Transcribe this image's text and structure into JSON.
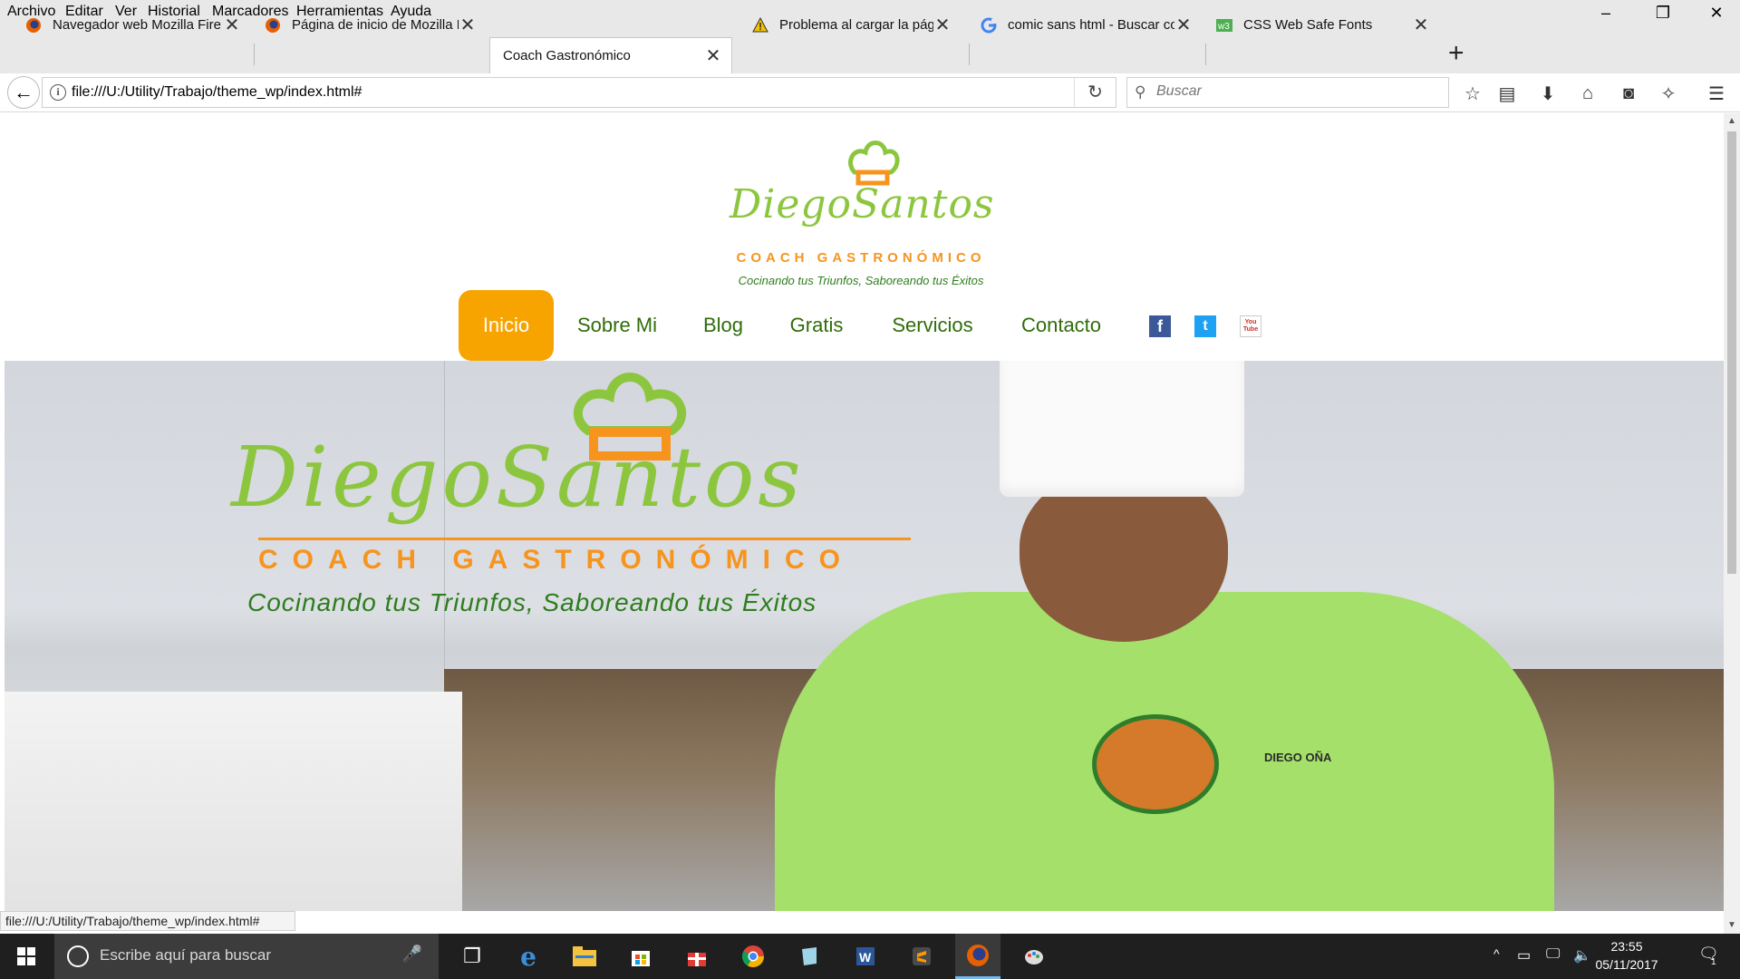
{
  "menu": [
    "Archivo",
    "Editar",
    "Ver",
    "Historial",
    "Marcadores",
    "Herramientas",
    "Ayuda"
  ],
  "window_controls": {
    "minimize": "–",
    "restore": "❐",
    "close": "✕"
  },
  "tabs": [
    {
      "label": "Navegador web Mozilla Fire",
      "icon": "firefox-icon"
    },
    {
      "label": "Página de inicio de Mozilla F",
      "icon": "firefox-icon"
    },
    {
      "label": "Coach Gastronómico",
      "icon": "",
      "active": true
    },
    {
      "label": "Problema al cargar la página",
      "icon": "warning-icon"
    },
    {
      "label": "comic sans html - Buscar co",
      "icon": "google-icon"
    },
    {
      "label": "CSS Web Safe Fonts",
      "icon": "w3schools-icon"
    }
  ],
  "tab_close": "✕",
  "new_tab": "+",
  "navbar": {
    "url": "file:///U:/Utility/Trabajo/theme_wp/index.html#",
    "search_placeholder": "Buscar",
    "back": "←",
    "reload": "↻",
    "info": "i",
    "search_icon": "⚲"
  },
  "toolbar_icons": [
    "☆",
    "▤",
    "⬇",
    "⌂",
    "◙",
    "✧",
    "☰"
  ],
  "site": {
    "logo": {
      "brand": "DiegoSantos",
      "coach": "COACH GASTRONÓMICO",
      "tagline": "Cocinando tus Triunfos, Saboreando tus Éxitos"
    },
    "nav": [
      {
        "label": "Inicio",
        "active": true
      },
      {
        "label": "Sobre Mi"
      },
      {
        "label": "Blog"
      },
      {
        "label": "Gratis"
      },
      {
        "label": "Servicios"
      },
      {
        "label": "Contacto"
      }
    ],
    "social": {
      "facebook": "f",
      "twitter": "t",
      "youtube": "You Tube"
    },
    "hero": {
      "brand": "DiegoSantos",
      "coach": "COACH GASTRONÓMICO",
      "tagline": "Cocinando tus Triunfos, Saboreando tus Éxitos",
      "jacket_name": "DIEGO OÑA"
    }
  },
  "status_url": "file:///U:/Utility/Trabajo/theme_wp/index.html#",
  "taskbar": {
    "search_placeholder": "Escribe aquí para buscar",
    "time": "23:55",
    "date": "05/11/2017",
    "notification_count": "1"
  },
  "colors": {
    "green": "#8cc63f",
    "orange": "#f7941d",
    "nav_active": "#f7a400",
    "nav_text": "#2f6d0a"
  }
}
